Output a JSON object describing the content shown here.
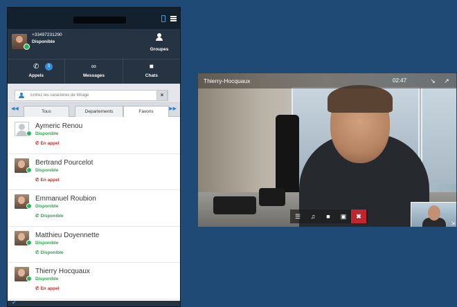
{
  "app": {
    "user": {
      "phone": "+33497231290",
      "status": "Disponible"
    },
    "groups_label": "Groupes",
    "tabs": [
      {
        "label": "Appels",
        "icon": "phone-icon",
        "badge": "3"
      },
      {
        "label": "Messages",
        "icon": "voicemail-icon"
      },
      {
        "label": "Chats",
        "icon": "chat-icon"
      }
    ],
    "filter_placeholder": "Entrez les caractères de filtrage",
    "filter_clear": "×",
    "subtabs": [
      "Tous",
      "Departements",
      "Favoris"
    ],
    "contacts": [
      {
        "name": "Aymeric Renou",
        "status": "Disponible",
        "call": "En appel",
        "call_state": "busy"
      },
      {
        "name": "Bertrand Pourcelot",
        "status": "Disponible",
        "call": "En appel",
        "call_state": "busy"
      },
      {
        "name": "Emmanuel Roubion",
        "status": "Disponible",
        "call": "Disponible",
        "call_state": "free"
      },
      {
        "name": "Matthieu Doyennette",
        "status": "Disponible",
        "call": "Disponible",
        "call_state": "free"
      },
      {
        "name": "Thierry Hocquaux",
        "status": "Disponible",
        "call": "En appel",
        "call_state": "busy"
      }
    ]
  },
  "video": {
    "title": "Thierry-Hocquaux",
    "duration": "02:47"
  },
  "colors": {
    "background": "#1f4a75",
    "available": "#2ca44a",
    "busy": "#d62424",
    "hangup": "#c0262d",
    "accent": "#2f8ee0"
  }
}
